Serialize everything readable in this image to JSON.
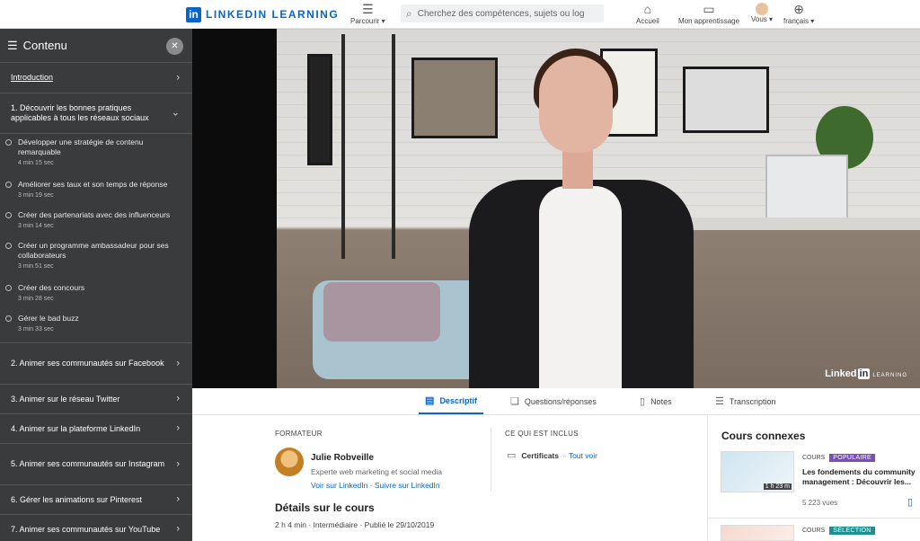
{
  "brand": {
    "logo_letters": "in",
    "name": "LINKEDIN LEARNING"
  },
  "nav": {
    "parcourir": "Parcourir",
    "search_placeholder": "Cherchez des compétences, sujets ou log",
    "accueil": "Accueil",
    "apprentissage": "Mon apprentissage",
    "vous": "Vous",
    "langue": "français"
  },
  "sidebar": {
    "title": "Contenu",
    "intro": "Introduction",
    "open_chapter": "1. Découvrir les bonnes pratiques applicables à tous les réseaux sociaux",
    "lessons": [
      {
        "title": "Développer une stratégie de contenu remarquable",
        "dur": "4 min 15 sec"
      },
      {
        "title": "Améliorer ses taux et son temps de réponse",
        "dur": "3 min 19 sec"
      },
      {
        "title": "Créer des partenariats avec des influenceurs",
        "dur": "3 min 14 sec"
      },
      {
        "title": "Créer un programme ambassadeur pour ses collaborateurs",
        "dur": "3 min 51 sec"
      },
      {
        "title": "Créer des concours",
        "dur": "3 min 28 sec"
      },
      {
        "title": "Gérer le bad buzz",
        "dur": "3 min 33 sec"
      }
    ],
    "chapters": [
      "2. Animer ses communautés sur Facebook",
      "3. Animer sur le réseau Twitter",
      "4. Animer sur la plateforme LinkedIn",
      "5. Animer ses communautés sur Instagram",
      "6. Gérer les animations sur Pinterest",
      "7. Animer ses communautés sur YouTube"
    ]
  },
  "video": {
    "watermark_a": "Linked",
    "watermark_b": "in",
    "watermark_c": "LEARNING"
  },
  "tabs": [
    "Descriptif",
    "Questions/réponses",
    "Notes",
    "Transcription"
  ],
  "main": {
    "formateur_label": "FORMATEUR",
    "trainer_name": "Julie Robveille",
    "trainer_role": "Experte web marketing et social media",
    "trainer_links": "Voir sur LinkedIn · Suivre sur LinkedIn",
    "inclus_label": "CE QUI EST INCLUS",
    "certificats": "Certificats",
    "tout_voir": "Tout voir",
    "details_title": "Détails sur le cours",
    "details_meta": "2 h 4 min · Intermédiaire · Publié le 29/10/2019"
  },
  "related": {
    "title": "Cours connexes",
    "items": [
      {
        "kind": "COURS",
        "badge": "POPULAIRE",
        "title": "Les fondements du community management : Découvrir les...",
        "duration": "1 h 23 m",
        "views": "5 223 vues"
      },
      {
        "kind": "COURS",
        "badge": "SÉLECTION"
      }
    ]
  }
}
